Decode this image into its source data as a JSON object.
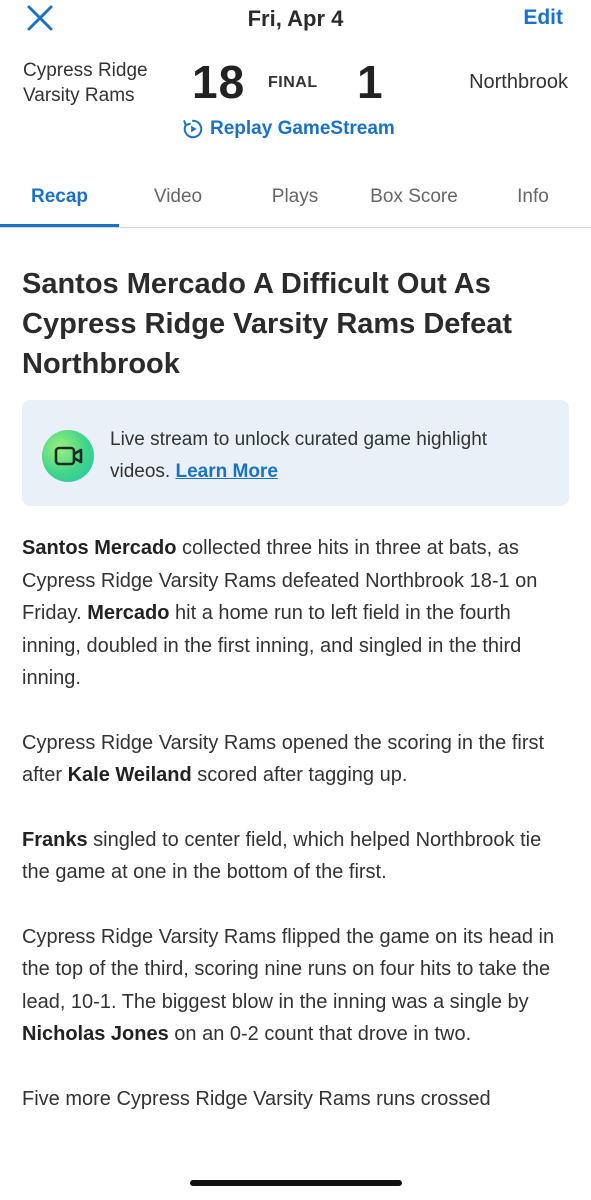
{
  "header": {
    "date": "Fri, Apr 4",
    "edit_label": "Edit",
    "close_icon": "close-icon"
  },
  "scoreboard": {
    "home_team": "Cypress Ridge Varsity Rams",
    "home_team_line1": "Cypress Ridge",
    "home_team_line2": "Varsity Rams",
    "home_score": "18",
    "status": "FINAL",
    "away_score": "1",
    "away_team": "Northbrook",
    "replay_label": "Replay GameStream"
  },
  "tabs": [
    {
      "label": "Recap",
      "active": true
    },
    {
      "label": "Video",
      "active": false
    },
    {
      "label": "Plays",
      "active": false
    },
    {
      "label": "Box Score",
      "active": false
    },
    {
      "label": "Info",
      "active": false
    }
  ],
  "article": {
    "headline": "Santos Mercado A Difficult Out As Cypress Ridge Varsity Rams Defeat Northbrook",
    "promo_text": "Live stream to unlock curated game highlight videos.",
    "promo_link": "Learn More",
    "p1_bold1": "Santos Mercado",
    "p1_text1": " collected three hits in three at bats, as Cypress Ridge Varsity Rams defeated Northbrook 18-1 on Friday. ",
    "p1_bold2": "Mercado",
    "p1_text2": " hit a home run to left field in the fourth inning, doubled in the first inning, and singled in the third inning.",
    "p2_text1": "Cypress Ridge Varsity Rams opened the scoring in the first after ",
    "p2_bold1": "Kale Weiland",
    "p2_text2": " scored after tagging up.",
    "p3_bold1": "Franks",
    "p3_text1": " singled to center field, which helped Northbrook tie the game at one in the bottom of the first.",
    "p4_text1": "Cypress Ridge Varsity Rams flipped the game on its head in the top of the third, scoring nine runs on four hits to take the lead, 10-1. The biggest blow in the inning was a single by ",
    "p4_bold1": "Nicholas Jones",
    "p4_text2": " on an 0-2 count that drove in two.",
    "p5_text1": "Five more Cypress Ridge Varsity Rams runs crossed"
  },
  "colors": {
    "accent": "#1a72c8",
    "promo_bg": "#eaf0f7",
    "text": "#333333"
  }
}
